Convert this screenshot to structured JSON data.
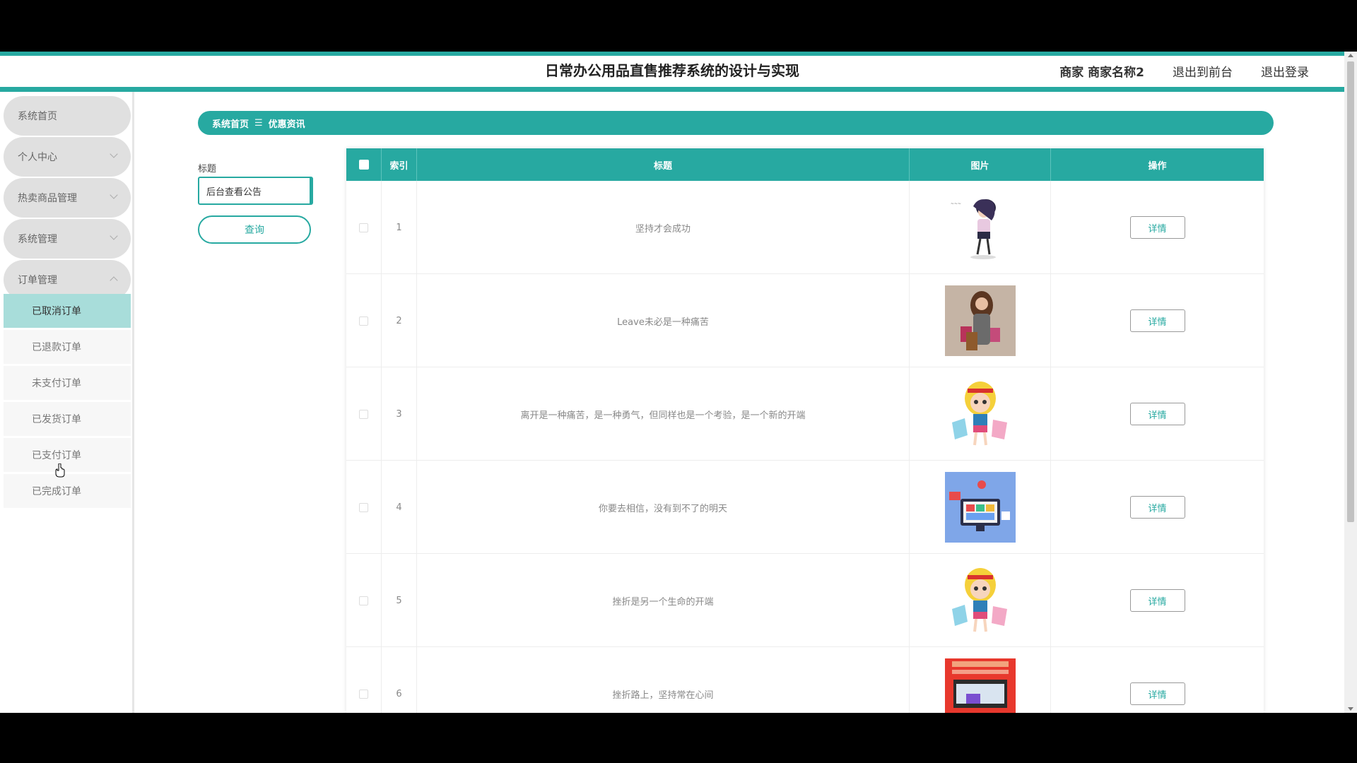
{
  "header": {
    "title": "日常办公用品直售推荐系统的设计与实现",
    "user_label": "商家 商家名称2",
    "to_front": "退出到前台",
    "logout": "退出登录"
  },
  "sidebar": {
    "items": [
      {
        "label": "系统首页",
        "chevron": "none"
      },
      {
        "label": "个人中心",
        "chevron": "down"
      },
      {
        "label": "热卖商品管理",
        "chevron": "down"
      },
      {
        "label": "系统管理",
        "chevron": "down"
      },
      {
        "label": "订单管理",
        "chevron": "up"
      }
    ],
    "sub_items": [
      {
        "label": "已取消订单",
        "active": true
      },
      {
        "label": "已退款订单",
        "active": false
      },
      {
        "label": "未支付订单",
        "active": false
      },
      {
        "label": "已发货订单",
        "active": false
      },
      {
        "label": "已支付订单",
        "active": false
      },
      {
        "label": "已完成订单",
        "active": false
      }
    ]
  },
  "breadcrumb": {
    "home": "系统首页",
    "separator": "☰",
    "current": "优惠资讯"
  },
  "search": {
    "label": "标题",
    "value": "后台查看公告",
    "button": "查询"
  },
  "table": {
    "headers": {
      "index": "索引",
      "title": "标题",
      "image": "图片",
      "action": "操作"
    },
    "rows": [
      {
        "index": "1",
        "title": "坚持才会成功",
        "image": "fashion-girl-sketch-image",
        "action": "详情"
      },
      {
        "index": "2",
        "title": "Leave未必是一种痛苦",
        "image": "woman-shopping-bags-photo",
        "action": "详情"
      },
      {
        "index": "3",
        "title": "离开是一种痛苦，是一种勇气，但同样也是一个考验，是一个新的开端",
        "image": "cartoon-shopping-girl-image",
        "action": "详情"
      },
      {
        "index": "4",
        "title": "你要去相信，没有到不了的明天",
        "image": "online-shopping-monitor-image",
        "action": "详情"
      },
      {
        "index": "5",
        "title": "挫折是另一个生命的开端",
        "image": "cartoon-shopping-girl-image",
        "action": "详情"
      },
      {
        "index": "6",
        "title": "挫折路上，坚持常在心间",
        "image": "red-promo-banner-image",
        "action": "详情"
      }
    ]
  },
  "colors": {
    "accent": "#27a9a1",
    "active_sub": "#a8ddda",
    "menu_bg": "#e0e0e0"
  }
}
